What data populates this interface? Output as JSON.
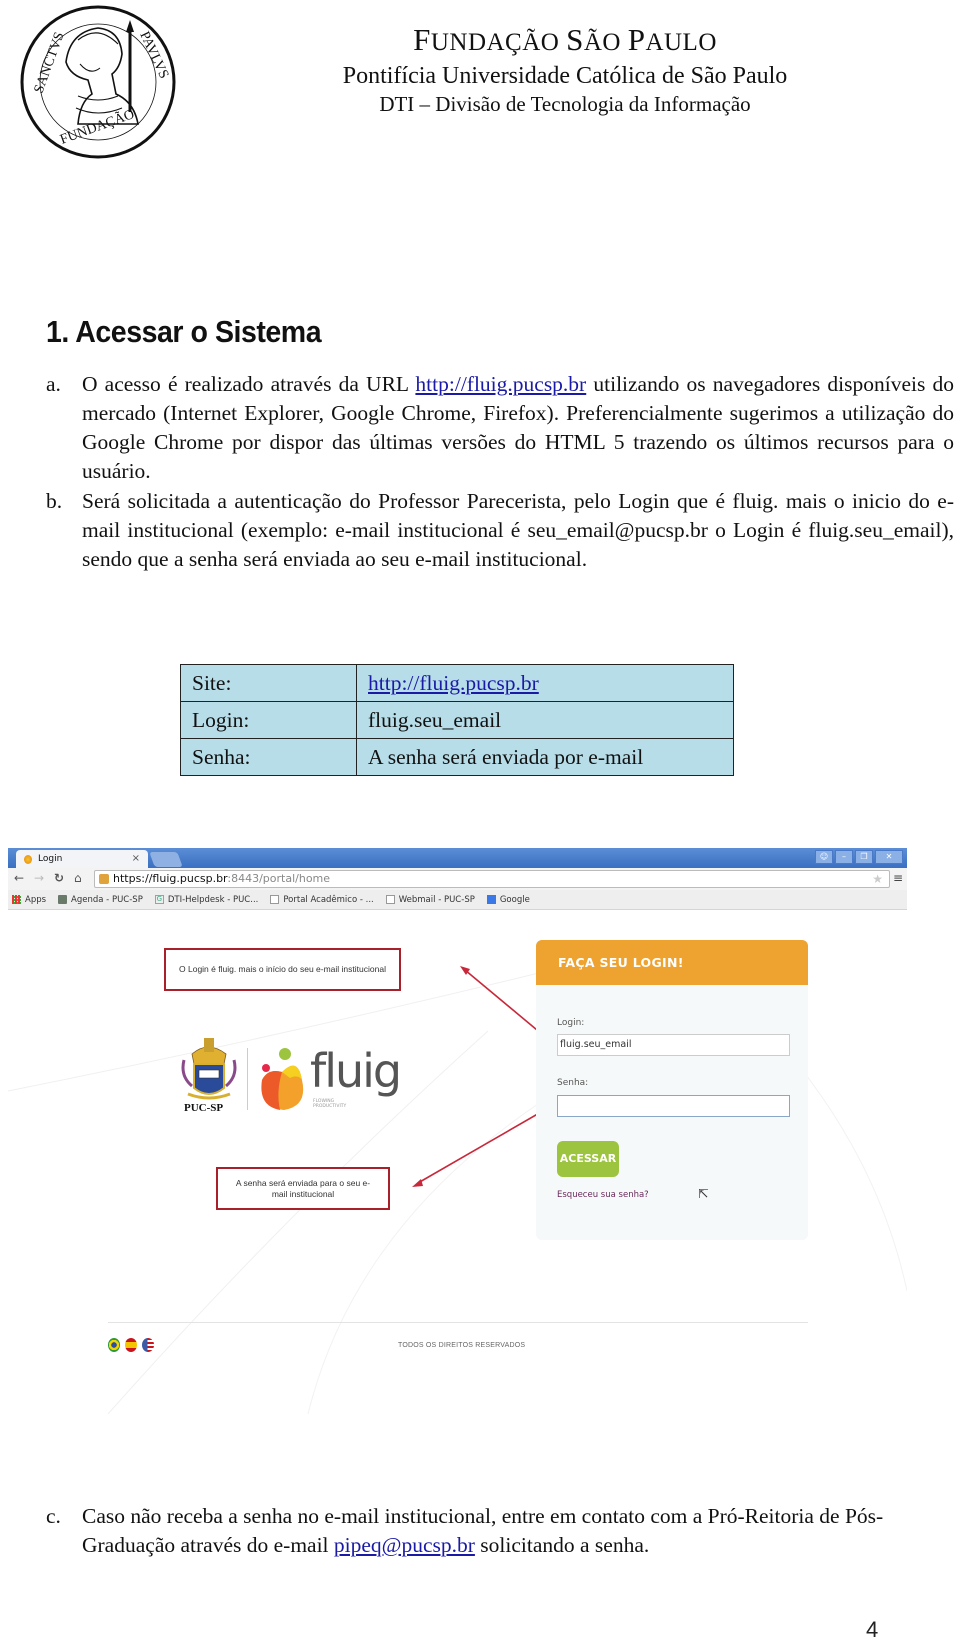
{
  "header": {
    "org_line1": "Fundação São Paulo",
    "org_line1_parts": [
      "F",
      "UNDAÇÃO ",
      "S",
      "ÃO ",
      "P",
      "AULO"
    ],
    "org_line2": "Pontifícia Universidade Católica de São Paulo",
    "org_line3": "DTI – Divisão de Tecnologia da Informação",
    "seal_text_top": "SANCTVS PAVLVS",
    "seal_text_bottom": "FUNDAÇÃO"
  },
  "section": {
    "title": "1. Acessar o Sistema",
    "items": [
      {
        "marker": "a.",
        "text_before_link": "O acesso é realizado através da URL ",
        "link": "http://fluig.pucsp.br",
        "text_after_link": " utilizando os navegadores disponíveis do mercado (Internet Explorer, Google Chrome, Firefox). Preferencialmente sugerimos a utilização do Google Chrome por dispor das últimas versões do HTML 5 trazendo os últimos recursos para  o usuário."
      },
      {
        "marker": "b.",
        "text": "Será solicitada a autenticação do Professor Parecerista, pelo Login que é fluig. mais o inicio do e-mail institucional (exemplo: e-mail institucional é seu_email@pucsp.br o Login é fluig.seu_email), sendo que a senha será enviada ao seu e-mail institucional."
      },
      {
        "marker": "c.",
        "text_before_link": "Caso não receba a senha no e-mail institucional, entre em contato com a Pró-Reitoria de Pós-Graduação através do e-mail ",
        "link": "pipeq@pucsp.br",
        "text_after_link": " solicitando a senha."
      }
    ]
  },
  "info_table": {
    "rows": [
      {
        "key": "Site:",
        "value": "http://fluig.pucsp.br",
        "is_link": true
      },
      {
        "key": "Login:",
        "value": "fluig.seu_email",
        "is_link": false
      },
      {
        "key": "Senha:",
        "value": "A senha será enviada por e-mail",
        "is_link": false
      }
    ]
  },
  "browser": {
    "tab_title": "Login",
    "address_host": "https://fluig.pucsp.br",
    "address_rest": ":8443/portal/home",
    "nav_icons": [
      "back-arrow-icon",
      "forward-arrow-icon",
      "reload-icon",
      "home-icon"
    ],
    "window_controls": [
      "profile-icon",
      "minimize-icon",
      "restore-icon",
      "close-icon"
    ],
    "bookmarks": [
      {
        "label": "Apps",
        "icon": "apps-grid-icon"
      },
      {
        "label": "Agenda - PUC-SP",
        "icon": "agenda-icon"
      },
      {
        "label": "DTI-Helpdesk - PUC...",
        "icon": "helpdesk-icon"
      },
      {
        "label": "Portal Acadêmico - ...",
        "icon": "page-icon"
      },
      {
        "label": "Webmail - PUC-SP",
        "icon": "page-icon"
      },
      {
        "label": "Google",
        "icon": "google-icon"
      }
    ]
  },
  "login_page": {
    "puc_label": "PUC-SP",
    "fluig_word": "fluig",
    "fluig_tagline_1": "FLOWING",
    "fluig_tagline_2": "PRODUCTIVITY",
    "card_title": "FAÇA SEU LOGIN!",
    "login_label": "Login:",
    "login_value": "fluig.seu_email",
    "password_label": "Senha:",
    "password_value": "",
    "submit_label": "ACESSAR",
    "forgot_link": "Esqueceu sua senha?",
    "footer_rights": "TODOS OS DIREITOS RESERVADOS",
    "languages": [
      "Português (Brasil)",
      "Español",
      "English"
    ],
    "callouts": [
      {
        "text": "O Login é fluig. mais o início do seu e-mail institucional"
      },
      {
        "text": "A senha será enviada para o seu e-mail institucional"
      }
    ],
    "colors": {
      "card_header": "#eea230",
      "submit_button": "#9dc43f",
      "callout_border": "#a8202a"
    }
  },
  "page_number": "4",
  "colors": {
    "link": "#1a1aa6",
    "table_bg": "#b7dde8"
  }
}
